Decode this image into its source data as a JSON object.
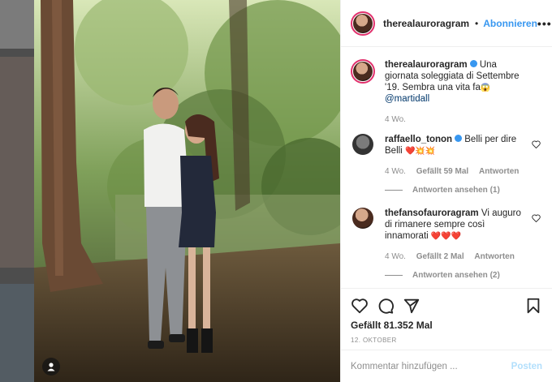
{
  "colors": {
    "accent": "#3897f0",
    "story_ring": "#e1306c",
    "heart": "#ed4956"
  },
  "post": {
    "username": "therealauroragram",
    "follow_label": "Abonnieren",
    "more_icon": "more-horizontal-icon",
    "caption": {
      "username": "therealauroragram",
      "text": "Una giornata soleggiata di Settembre '19. Sembra una vita fa",
      "emoji": "😱",
      "mention": "@martidall",
      "time": "4 Wo."
    },
    "comments": [
      {
        "username": "raffaello_tonon",
        "text": "Belli per dire Belli",
        "emoji": "❤️💥💥",
        "time": "4 Wo.",
        "likes": "Gefällt 59 Mal",
        "reply_label": "Antworten",
        "view_replies": "Antworten ansehen (1)"
      },
      {
        "username": "thefansofauroragram",
        "text": "Vi auguro di rimanere sempre così innamorati",
        "emoji": "❤️❤️❤️",
        "time": "4 Wo.",
        "likes": "Gefällt 2 Mal",
        "reply_label": "Antworten",
        "view_replies": "Antworten ansehen (2)"
      }
    ],
    "likes_count": "Gefällt 81.352 Mal",
    "date": "12. OKTOBER",
    "comment_placeholder": "Kommentar hinzufügen ...",
    "post_button": "Posten"
  }
}
